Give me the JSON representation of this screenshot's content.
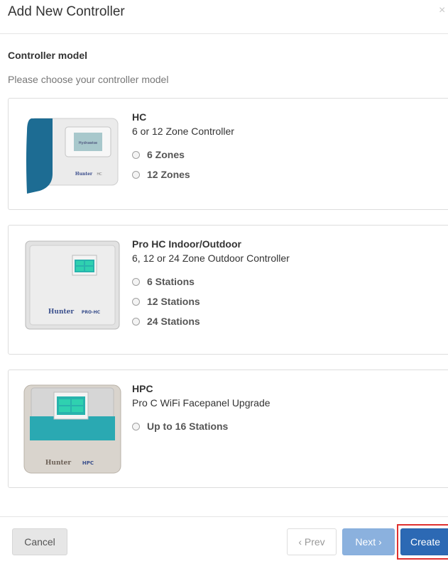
{
  "modal": {
    "title": "Add New Controller",
    "close_symbol": "×"
  },
  "section": {
    "label": "Controller model",
    "hint": "Please choose your controller model"
  },
  "models": [
    {
      "title": "HC",
      "description": "6 or 12 Zone Controller",
      "device_brand": "Hunter",
      "device_model": "HC",
      "options": [
        "6 Zones",
        "12 Zones"
      ]
    },
    {
      "title": "Pro HC Indoor/Outdoor",
      "description": "6, 12 or 24 Zone Outdoor Controller",
      "device_brand": "Hunter",
      "device_model": "PRO-HC",
      "options": [
        "6 Stations",
        "12 Stations",
        "24 Stations"
      ]
    },
    {
      "title": "HPC",
      "description": "Pro C WiFi Facepanel Upgrade",
      "device_brand": "Hunter",
      "device_model": "HPC",
      "options": [
        "Up to 16 Stations"
      ]
    }
  ],
  "footer": {
    "cancel_label": "Cancel",
    "prev_label": "‹ Prev",
    "next_label": "Next ›",
    "create_label": "Create"
  },
  "colors": {
    "primary": "#2c69b4",
    "primary_disabled": "#8bb1de",
    "highlight": "#e0302e",
    "hc_accent": "#1d6c93",
    "screen_teal": "#28b3ad"
  }
}
